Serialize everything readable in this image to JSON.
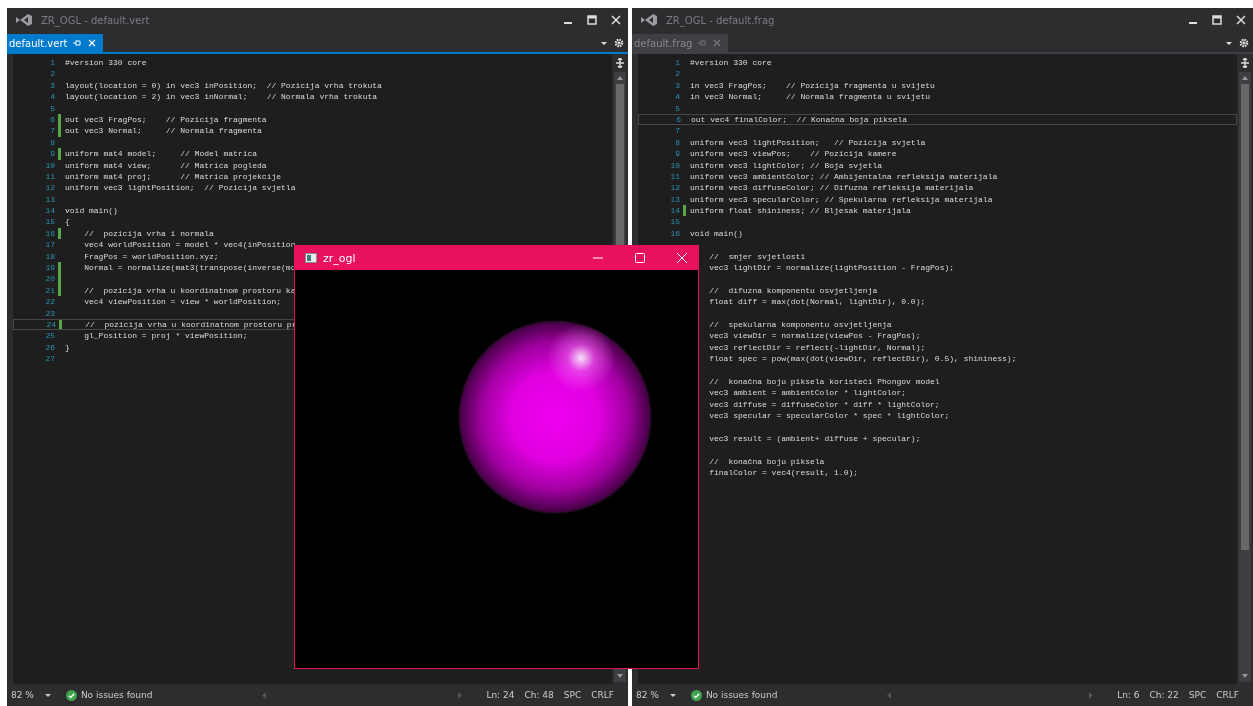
{
  "editors": [
    {
      "window_title": "ZR_OGL - default.vert",
      "tab": {
        "label": "default.vert",
        "selected": true
      },
      "lines": [
        {
          "n": "1",
          "text": "#version 330 core",
          "changed": false,
          "current": false
        },
        {
          "n": "2",
          "changed": false,
          "current": false
        },
        {
          "n": "3",
          "text": "layout(location = 0) in vec3 inPosition;  // Pozicija vrha trokuta",
          "changed": false,
          "current": false
        },
        {
          "n": "4",
          "text": "layout(location = 2) in vec3 inNormal;    // Normala vrha trokuta",
          "changed": false,
          "current": false
        },
        {
          "n": "5",
          "changed": false,
          "current": false
        },
        {
          "n": "6",
          "text": "out vec3 FragPos;    // Pozicija fragmenta",
          "changed": true,
          "current": false
        },
        {
          "n": "7",
          "text": "out vec3 Normal;     // Normala fragmenta",
          "changed": true,
          "current": false
        },
        {
          "n": "8",
          "changed": false,
          "current": false
        },
        {
          "n": "9",
          "text": "uniform mat4 model;     // Model matrica",
          "changed": true,
          "current": false
        },
        {
          "n": "10",
          "text": "uniform mat4 view;      // Matrica pogleda",
          "changed": false,
          "current": false
        },
        {
          "n": "11",
          "text": "uniform mat4 proj;      // Matrica projekcije",
          "changed": false,
          "current": false
        },
        {
          "n": "12",
          "text": "uniform vec3 lightPosition;  // Pozicija svjetla",
          "changed": false,
          "current": false
        },
        {
          "n": "13",
          "changed": false,
          "current": false
        },
        {
          "n": "14",
          "text": "void main()",
          "changed": false,
          "current": false
        },
        {
          "n": "15",
          "text": "{",
          "changed": false,
          "current": false
        },
        {
          "n": "16",
          "text": "    //  pozicija vrha i normala",
          "changed": true,
          "current": false
        },
        {
          "n": "17",
          "text": "    vec4 worldPosition = model * vec4(inPosition",
          "changed": false,
          "current": false
        },
        {
          "n": "18",
          "text": "    FragPos = worldPosition.xyz;",
          "changed": false,
          "current": false
        },
        {
          "n": "19",
          "text": "    Normal = normalize(mat3(transpose(inverse(mo",
          "changed": true,
          "current": false
        },
        {
          "n": "20",
          "changed": true,
          "current": false
        },
        {
          "n": "21",
          "text": "    //  pozicija vrha u koordinatnom prostoru ka",
          "changed": true,
          "current": false
        },
        {
          "n": "22",
          "text": "    vec4 viewPosition = view * worldPosition;",
          "changed": false,
          "current": false
        },
        {
          "n": "23",
          "changed": false,
          "current": false
        },
        {
          "n": "24",
          "text": "    //  pozicija vrha u koordinatnom prostoru pr",
          "changed": true,
          "current": true
        },
        {
          "n": "25",
          "text": "    gl_Position = proj * viewPosition;",
          "changed": false,
          "current": false
        },
        {
          "n": "26",
          "text": "}",
          "changed": false,
          "current": false
        },
        {
          "n": "27",
          "changed": false,
          "current": false
        }
      ],
      "status": {
        "zoom": "82 %",
        "issues": "No issues found",
        "line": "Ln: 24",
        "column": "Ch: 48",
        "spacing": "SPC",
        "line_ending": "CRLF"
      }
    },
    {
      "window_title": "ZR_OGL - default.frag",
      "tab": {
        "label": "default.frag",
        "selected": false
      },
      "lines": [
        {
          "n": "1",
          "text": "#version 330 core",
          "changed": false,
          "current": false
        },
        {
          "n": "2",
          "changed": false,
          "current": false
        },
        {
          "n": "3",
          "text": "in vec3 FragPos;    // Pozicija fragmenta u svijetu",
          "changed": false,
          "current": false
        },
        {
          "n": "4",
          "text": "in vec3 Normal;     // Normala fragmenta u svijetu",
          "changed": false,
          "current": false
        },
        {
          "n": "5",
          "changed": false,
          "current": false
        },
        {
          "n": "6",
          "text": "out vec4 finalColor;  // Konačna boja piksela",
          "changed": false,
          "current": true
        },
        {
          "n": "7",
          "changed": false,
          "current": false
        },
        {
          "n": "8",
          "text": "uniform vec3 lightPosition;   // Pozicija svjetla",
          "changed": false,
          "current": false
        },
        {
          "n": "9",
          "text": "uniform vec3 viewPos;    // Pozicija kamere",
          "changed": false,
          "current": false
        },
        {
          "n": "10",
          "text": "uniform vec3 lightColor; // Boja svjetla",
          "changed": false,
          "current": false
        },
        {
          "n": "11",
          "text": "uniform vec3 ambientColor; // Ambijentalna refleksija materijala",
          "changed": false,
          "current": false
        },
        {
          "n": "12",
          "text": "uniform vec3 diffuseColor; // Difuzna refleksija materijala",
          "changed": false,
          "current": false
        },
        {
          "n": "13",
          "text": "uniform vec3 specularColor; // Spekularna refleksija materijala",
          "changed": false,
          "current": false
        },
        {
          "n": "14",
          "text": "uniform float shininess; // Bljesak materijala",
          "changed": true,
          "current": false
        },
        {
          "n": "15",
          "changed": false,
          "current": false
        },
        {
          "n": "16",
          "text": "void main()",
          "changed": false,
          "current": false
        },
        {
          "current": false
        },
        {
          "text": "    //  smjer svjetlosti",
          "current": false
        },
        {
          "text": "    vec3 lightDir = normalize(lightPosition - FragPos);",
          "current": false
        },
        {
          "current": false
        },
        {
          "text": "    //  difuzna komponentu osvjetljenja",
          "current": false
        },
        {
          "text": "    float diff = max(dot(Normal, lightDir), 0.0);",
          "current": false
        },
        {
          "current": false
        },
        {
          "text": "    //  spekularna komponentu osvjetljenja",
          "current": false
        },
        {
          "text": "    vec3 viewDir = normalize(viewPos - FragPos);",
          "current": false
        },
        {
          "text": "    vec3 reflectDir = reflect(-lightDir, Normal);",
          "current": false
        },
        {
          "text": "    float spec = pow(max(dot(viewDir, reflectDir), 0.5), shininess);",
          "current": false
        },
        {
          "current": false
        },
        {
          "text": "    //  konačna boju piksela koristeći Phongov model",
          "current": false
        },
        {
          "text": "    vec3 ambient = ambientColor * lightColor;",
          "current": false
        },
        {
          "text": "    vec3 diffuse = diffuseColor * diff * lightColor;",
          "current": false
        },
        {
          "text": "    vec3 specular = specularColor * spec * lightColor;",
          "current": false
        },
        {
          "current": false
        },
        {
          "text": "    vec3 result = (ambient+ diffuse + specular);",
          "current": false
        },
        {
          "current": false
        },
        {
          "text": "    //  konačna boju piksela",
          "current": false
        },
        {
          "text": "    finalColor = vec4(result, 1.0);",
          "current": false
        }
      ],
      "status": {
        "zoom": "82 %",
        "issues": "No issues found",
        "line": "Ln: 6",
        "column": "Ch: 22",
        "spacing": "SPC",
        "line_ending": "CRLF"
      }
    }
  ],
  "app_window": {
    "title": "zr_ogl"
  }
}
